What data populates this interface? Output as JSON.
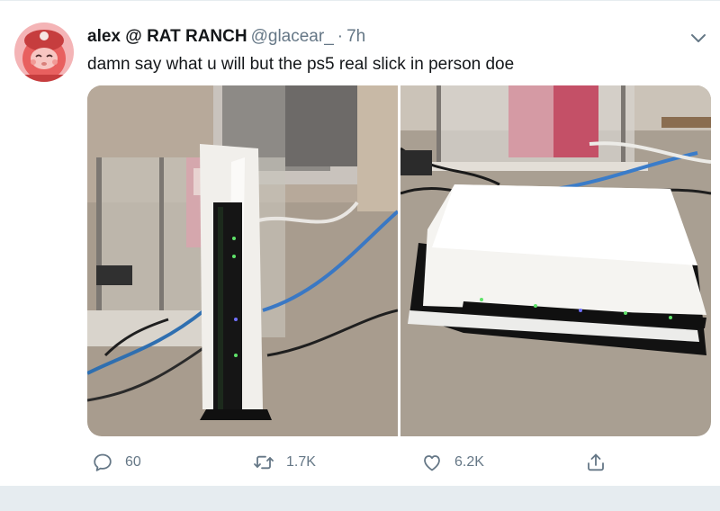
{
  "tweet": {
    "display_name": "alex @ RAT RANCH",
    "handle": "@glacear_",
    "separator": "·",
    "time": "7h",
    "text": "damn say what u will but the ps5 real slick in person doe",
    "images": [
      {
        "icon": "photo",
        "alt": "PS5 standing vertically on carpet half covered with a paper towel"
      },
      {
        "icon": "photo",
        "alt": "PS5 lying horizontally on carpet covered with a paper towel"
      }
    ]
  },
  "actions": {
    "reply_count": "60",
    "retweet_count": "1.7K",
    "like_count": "6.2K"
  },
  "colors": {
    "text_primary": "#14171a",
    "text_secondary": "#657786",
    "divider": "#e6ecf0"
  }
}
